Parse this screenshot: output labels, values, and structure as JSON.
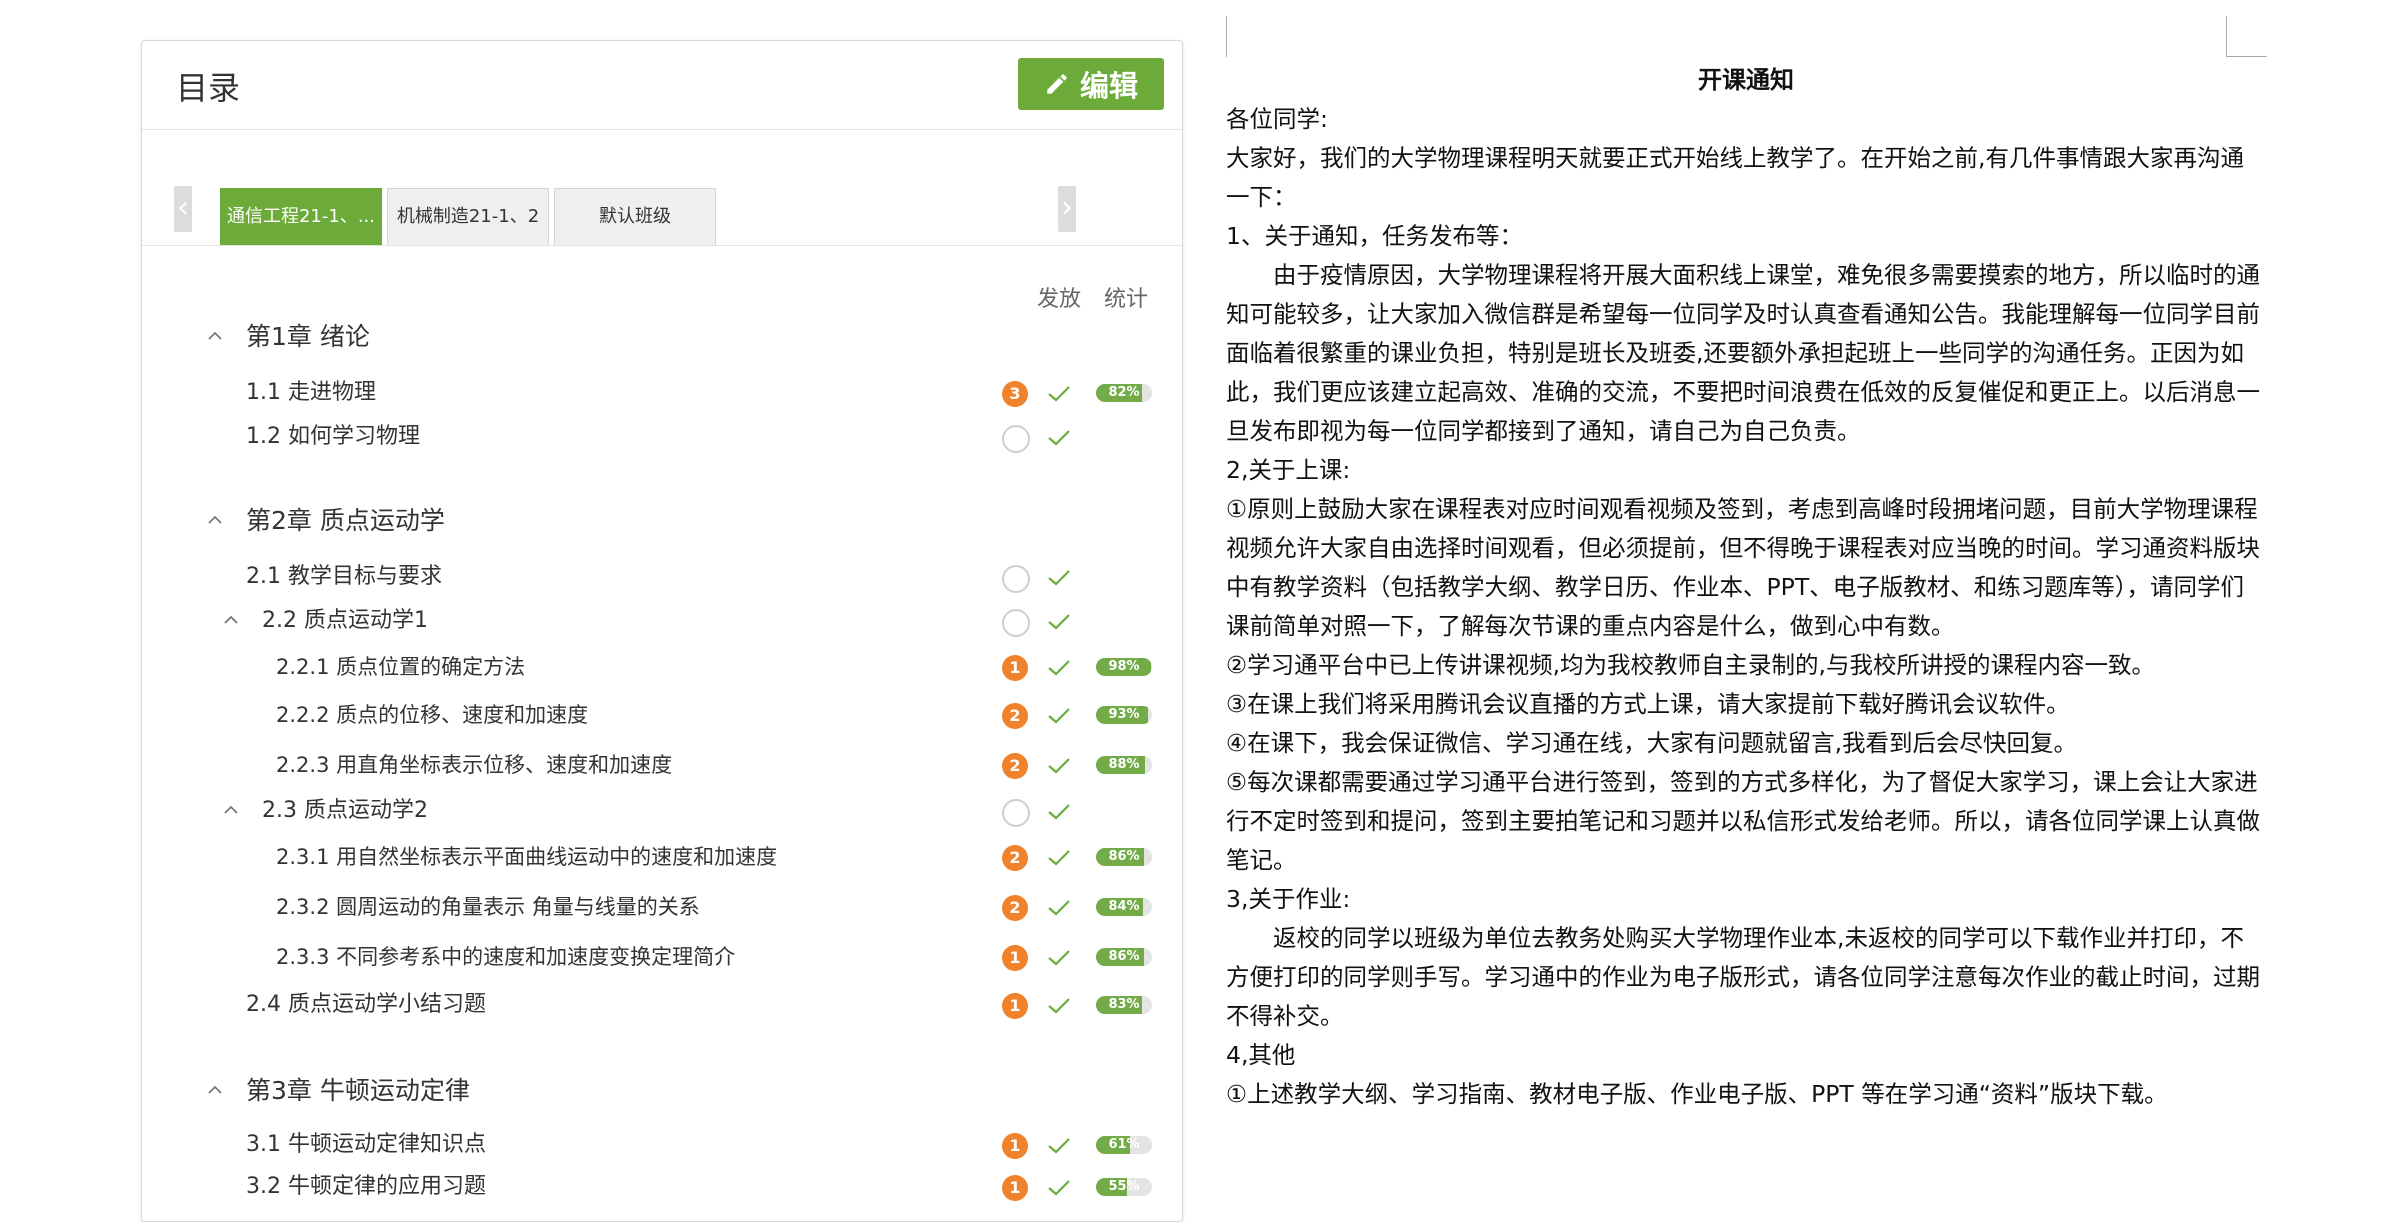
{
  "toc": {
    "title": "目录",
    "edit_label": "编辑",
    "tabs": [
      "通信工程21-1、...",
      "机械制造21-1、2",
      "默认班级"
    ],
    "col_release": "发放",
    "col_stats": "统计",
    "rows": [
      {
        "type": "chapter",
        "label": "第1章  绪论"
      },
      {
        "type": "lesson",
        "label": "1.1  走进物理",
        "badge": "3",
        "pct": 82,
        "pct_label": "82%"
      },
      {
        "type": "lesson",
        "label": "1.2  如何学习物理"
      },
      {
        "type": "chapter",
        "label": "第2章  质点运动学"
      },
      {
        "type": "lesson",
        "label": "2.1  教学目标与要求"
      },
      {
        "type": "sub",
        "label": "2.2  质点运动学1"
      },
      {
        "type": "subsub",
        "label": "2.2.1 质点位置的确定方法",
        "badge": "1",
        "pct": 98,
        "pct_label": "98%"
      },
      {
        "type": "subsub",
        "label": "2.2.2 质点的位移、速度和加速度",
        "badge": "2",
        "pct": 93,
        "pct_label": "93%"
      },
      {
        "type": "subsub",
        "label": "2.2.3 用直角坐标表示位移、速度和加速度",
        "badge": "2",
        "pct": 88,
        "pct_label": "88%"
      },
      {
        "type": "sub",
        "label": "2.3  质点运动学2"
      },
      {
        "type": "subsub",
        "label": "2.3.1 用自然坐标表示平面曲线运动中的速度和加速度",
        "badge": "2",
        "pct": 86,
        "pct_label": "86%"
      },
      {
        "type": "subsub",
        "label": "2.3.2 圆周运动的角量表示 角量与线量的关系",
        "badge": "2",
        "pct": 84,
        "pct_label": "84%"
      },
      {
        "type": "subsub",
        "label": "2.3.3 不同参考系中的速度和加速度变换定理简介",
        "badge": "1",
        "pct": 86,
        "pct_label": "86%"
      },
      {
        "type": "lesson",
        "label": "2.4  质点运动学小结习题",
        "badge": "1",
        "pct": 83,
        "pct_label": "83%"
      },
      {
        "type": "chapter",
        "label": "第3章  牛顿运动定律"
      },
      {
        "type": "lesson",
        "label": "3.1  牛顿运动定律知识点",
        "badge": "1",
        "pct": 61,
        "pct_label": "61%"
      },
      {
        "type": "lesson",
        "label": "3.2  牛顿定律的应用习题",
        "badge": "1",
        "pct": 55,
        "pct_label": "55%"
      }
    ]
  },
  "doc": {
    "title": "开课通知",
    "paragraphs": [
      {
        "text": "各位同学:",
        "indent": false
      },
      {
        "text": "大家好，我们的大学物理课程明天就要正式开始线上教学了。在开始之前,有几件事情跟大家再沟通一下：",
        "indent": false
      },
      {
        "text": "1、关于通知，任务发布等：",
        "indent": false
      },
      {
        "text": "由于疫情原因，大学物理课程将开展大面积线上课堂，难免很多需要摸索的地方，所以临时的通知可能较多，让大家加入微信群是希望每一位同学及时认真查看通知公告。我能理解每一位同学目前面临着很繁重的课业负担，特别是班长及班委,还要额外承担起班上一些同学的沟通任务。正因为如此，我们更应该建立起高效、准确的交流，不要把时间浪费在低效的反复催促和更正上。以后消息一旦发布即视为每一位同学都接到了通知，请自己为自己负责。",
        "indent": true
      },
      {
        "text": "2,关于上课:",
        "indent": false
      },
      {
        "text": "①原则上鼓励大家在课程表对应时间观看视频及签到，考虑到高峰时段拥堵问题，目前大学物理课程视频允许大家自由选择时间观看，但必须提前，但不得晚于课程表对应当晚的时间。学习通资料版块中有教学资料（包括教学大纲、教学日历、作业本、PPT、电子版教材、和练习题库等），请同学们课前简单对照一下，了解每次节课的重点内容是什么，做到心中有数。",
        "indent": false
      },
      {
        "text": "②学习通平台中已上传讲课视频,均为我校教师自主录制的,与我校所讲授的课程内容一致。",
        "indent": false
      },
      {
        "text": "③在课上我们将采用腾讯会议直播的方式上课，请大家提前下载好腾讯会议软件。",
        "indent": false
      },
      {
        "text": "④在课下，我会保证微信、学习通在线，大家有问题就留言,我看到后会尽快回复。",
        "indent": false
      },
      {
        "text": "⑤每次课都需要通过学习通平台进行签到，签到的方式多样化，为了督促大家学习，课上会让大家进行不定时签到和提问，签到主要拍笔记和习题并以私信形式发给老师。所以，请各位同学课上认真做笔记。",
        "indent": false
      },
      {
        "text": "3,关于作业:",
        "indent": false
      },
      {
        "text": "返校的同学以班级为单位去教务处购买大学物理作业本,未返校的同学可以下载作业并打印，不方便打印的同学则手写。学习通中的作业为电子版形式，请各位同学注意每次作业的截止时间，过期不得补交。",
        "indent": true
      },
      {
        "text": "4,其他",
        "indent": false
      },
      {
        "text": "①上述教学大纲、学习指南、教材电子版、作业电子版、PPT 等在学习通“资料”版块下载。",
        "indent": false
      }
    ]
  },
  "colors": {
    "accent": "#6cab39",
    "badge": "#f0822c",
    "check": "#6cab39"
  }
}
